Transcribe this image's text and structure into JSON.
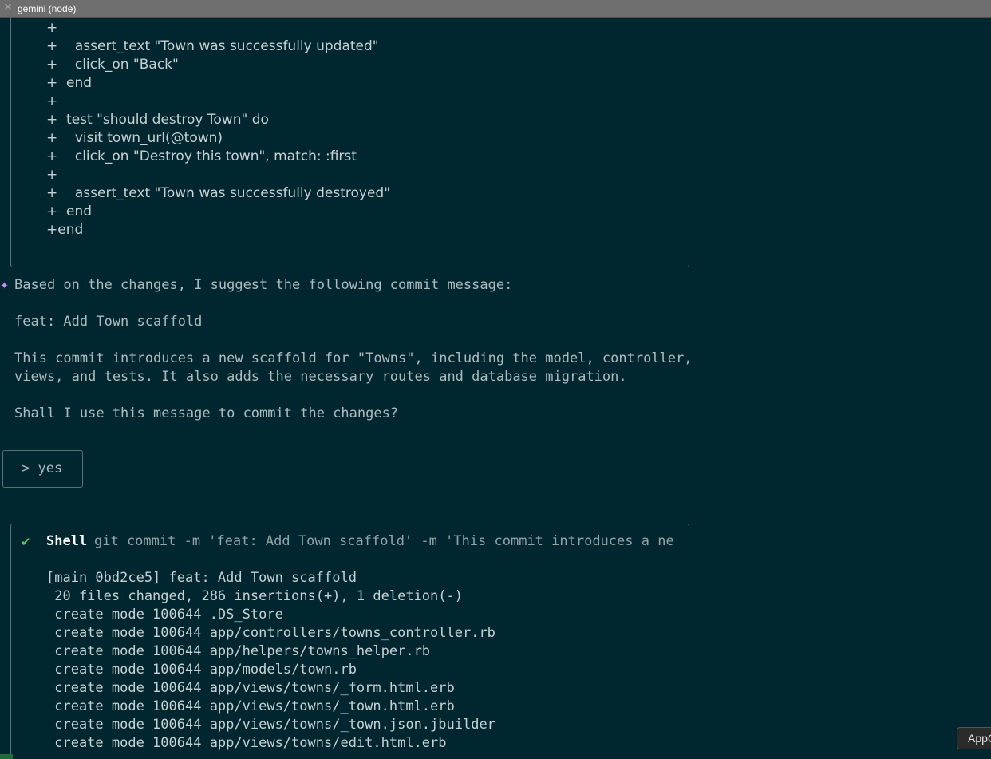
{
  "window": {
    "title": "gemini (node)",
    "close_icon": "close-icon"
  },
  "diff_block": {
    "lines": [
      "+",
      "+    assert_text \"Town was successfully updated\"",
      "+    click_on \"Back\"",
      "+  end",
      "+",
      "+  test \"should destroy Town\" do",
      "+    visit town_url(@town)",
      "+    click_on \"Destroy this town\", match: :first",
      "+",
      "+    assert_text \"Town was successfully destroyed\"",
      "+  end",
      "+end"
    ]
  },
  "assistant": {
    "icon": "sparkle-icon",
    "star_glyph": "✦",
    "line1": "Based on the changes, I suggest the following commit message:",
    "commit_title": "feat: Add Town scaffold",
    "body_line1": "This commit introduces a new scaffold for \"Towns\", including the model, controller,",
    "body_line2": "views, and tests. It also adds the necessary routes and database migration.",
    "question": "Shall I use this message to commit the changes?"
  },
  "user_prompt": {
    "text": "> yes"
  },
  "shell": {
    "status_glyph": "✔",
    "label": "Shell",
    "command": "git commit -m 'feat: Add Town scaffold' -m 'This commit introduces a ne…",
    "output": [
      "[main 0bd2ce5] feat: Add Town scaffold",
      " 20 files changed, 286 insertions(+), 1 deletion(-)",
      " create mode 100644 .DS_Store",
      " create mode 100644 app/controllers/towns_controller.rb",
      " create mode 100644 app/helpers/towns_helper.rb",
      " create mode 100644 app/models/town.rb",
      " create mode 100644 app/views/towns/_form.html.erb",
      " create mode 100644 app/views/towns/_town.html.erb",
      " create mode 100644 app/views/towns/_town.json.jbuilder",
      " create mode 100644 app/views/towns/edit.html.erb"
    ]
  },
  "overlay": {
    "app_tab_label": "AppC"
  }
}
